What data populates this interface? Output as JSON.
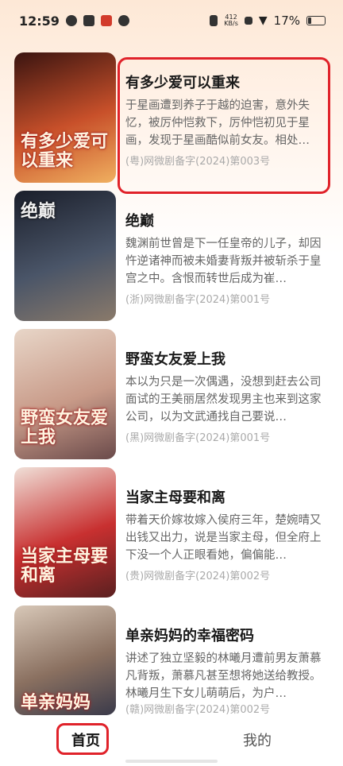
{
  "status_bar": {
    "time": "12:59",
    "net_speed_value": "412",
    "net_speed_unit": "KB/s",
    "battery": "17%"
  },
  "dramas": [
    {
      "title": "有多少爱可以重来",
      "poster_text": "有多少爱可以重来",
      "description": "于星画遭到养子于越的迫害，意外失忆，被厉仲恺救下，厉仲恺初见于星画，发现于星画酷似前女友。相处…",
      "registration": "(粤)网微剧备字(2024)第003号",
      "poster_colors": [
        "#3a1410",
        "#c8502a",
        "#f0b060"
      ]
    },
    {
      "title": "绝巅",
      "poster_text": "绝巅",
      "description": "魏渊前世曾是下一任皇帝的儿子，却因忤逆诸神而被未婚妻背叛并被斩杀于皇宫之中。含恨而转世后成为崔…",
      "registration": "(浙)网微剧备字(2024)第001号",
      "poster_colors": [
        "#1a1e2a",
        "#4a5568",
        "#8a7a6a"
      ]
    },
    {
      "title": "野蛮女友爱上我",
      "poster_text": "野蛮女友爱上我",
      "description": "本以为只是一次偶遇，没想到赶去公司面试的王美丽居然发现男主也来到这家公司，以为文武通找自己要说…",
      "registration": "(黑)网微剧备字(2024)第001号",
      "poster_colors": [
        "#e8d6c8",
        "#c89a88",
        "#6a4a4a"
      ]
    },
    {
      "title": "当家主母要和离",
      "poster_text": "当家主母要和离",
      "description": "带着天价嫁妆嫁入侯府三年，楚婉晴又出钱又出力，说是当家主母，但全府上下没一个人正眼看她，偏偏能…",
      "registration": "(贵)网微剧备字(2024)第002号",
      "poster_colors": [
        "#f0e0d8",
        "#c83030",
        "#5a2020"
      ]
    },
    {
      "title": "单亲妈妈的幸福密码",
      "poster_text": "单亲妈妈",
      "description": "讲述了独立坚毅的林曦月遭前男友萧慕凡背叛，萧慕凡甚至想将她送给教授。林曦月生下女儿萌萌后，为户…",
      "registration": "(赣)网微剧备字(2024)第002号",
      "poster_colors": [
        "#d8c8b8",
        "#8a7060",
        "#3a3a4a"
      ]
    }
  ],
  "bottom_nav": {
    "home": "首页",
    "mine": "我的"
  }
}
